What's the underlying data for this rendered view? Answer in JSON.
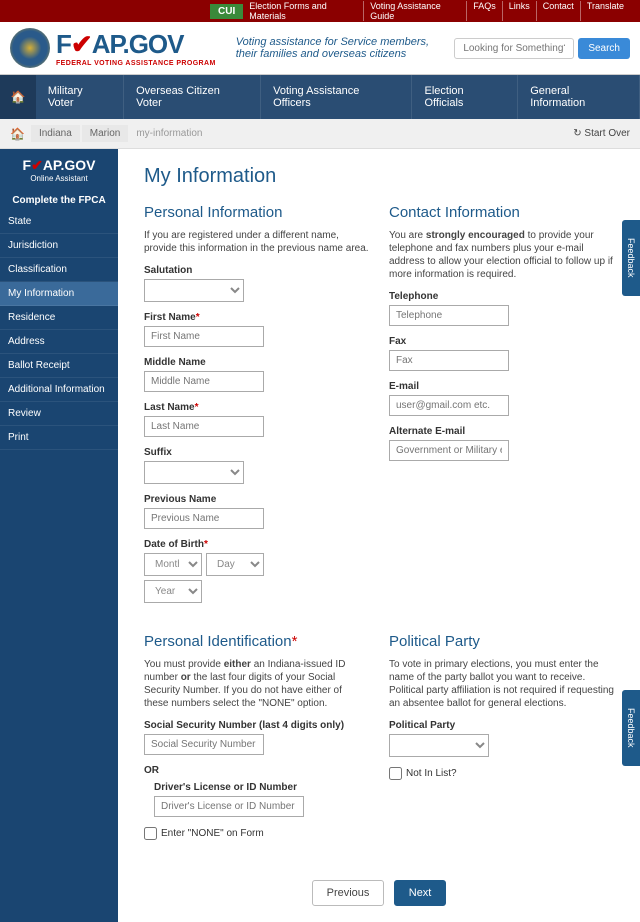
{
  "top": {
    "cui": "CUI",
    "links": [
      "Election Forms and Materials",
      "Voting Assistance Guide",
      "FAQs",
      "Links",
      "Contact",
      "Translate"
    ]
  },
  "header": {
    "logo_main": "FVAP",
    "logo_suffix": ".GOV",
    "tagline_red": "FEDERAL VOTING ASSISTANCE PROGRAM",
    "tagline_blue_1": "Voting assistance for Service members,",
    "tagline_blue_2": "their families and overseas citizens",
    "search_placeholder": "Looking for Something?",
    "search_btn": "Search"
  },
  "nav": {
    "items": [
      "Military Voter",
      "Overseas Citizen Voter",
      "Voting Assistance Officers",
      "Election Officials",
      "General Information"
    ]
  },
  "breadcrumb": {
    "items": [
      "Indiana",
      "Marion",
      "my-information"
    ],
    "start_over": "Start Over"
  },
  "sidebar": {
    "logo": "FVAP",
    "logo_suffix": ".GOV",
    "assist": "Online Assistant",
    "title": "Complete the FPCA",
    "items": [
      "State",
      "Jurisdiction",
      "Classification",
      "My Information",
      "Residence",
      "Address",
      "Ballot Receipt",
      "Additional Information",
      "Review",
      "Print"
    ],
    "active_index": 3
  },
  "page": {
    "title": "My Information",
    "personal": {
      "heading": "Personal Information",
      "help": "If you are registered under a different name, provide this information in the previous name area.",
      "salutation_label": "Salutation",
      "first_label": "First Name",
      "first_ph": "First Name",
      "middle_label": "Middle Name",
      "middle_ph": "Middle Name",
      "last_label": "Last Name",
      "last_ph": "Last Name",
      "suffix_label": "Suffix",
      "prev_label": "Previous Name",
      "prev_ph": "Previous Name",
      "dob_label": "Date of Birth",
      "dob_month": "Month",
      "dob_day": "Day",
      "dob_year": "Year"
    },
    "contact": {
      "heading": "Contact Information",
      "help_pre": "You are ",
      "help_strong": "strongly encouraged",
      "help_post": " to provide your telephone and fax numbers plus your e-mail address to allow your election official to follow up if more information is required.",
      "tel_label": "Telephone",
      "tel_ph": "Telephone",
      "fax_label": "Fax",
      "fax_ph": "Fax",
      "email_label": "E-mail",
      "email_ph": "user@gmail.com etc.",
      "alt_label": "Alternate E-mail",
      "alt_ph": "Government or Military email"
    },
    "ident": {
      "heading": "Personal Identification",
      "help_pre": "You must provide ",
      "help_b1": "either",
      "help_mid": " an Indiana-issued ID number ",
      "help_b2": "or",
      "help_post": " the last four digits of your Social Security Number. If you do not have either of these numbers select the \"NONE\" option.",
      "ssn_label": "Social Security Number (last 4 digits only)",
      "ssn_ph": "Social Security Number",
      "or": "OR",
      "dl_label": "Driver's License or ID Number",
      "dl_ph": "Driver's License or ID Number",
      "none_label": "Enter \"NONE\" on Form"
    },
    "party": {
      "heading": "Political Party",
      "help": "To vote in primary elections, you must enter the name of the party ballot you want to receive. Political party affiliation is not required if requesting an absentee ballot for general elections.",
      "label": "Political Party",
      "notlist": "Not In List?"
    },
    "prev_btn": "Previous",
    "next_btn": "Next"
  },
  "feedback": "Feedback"
}
